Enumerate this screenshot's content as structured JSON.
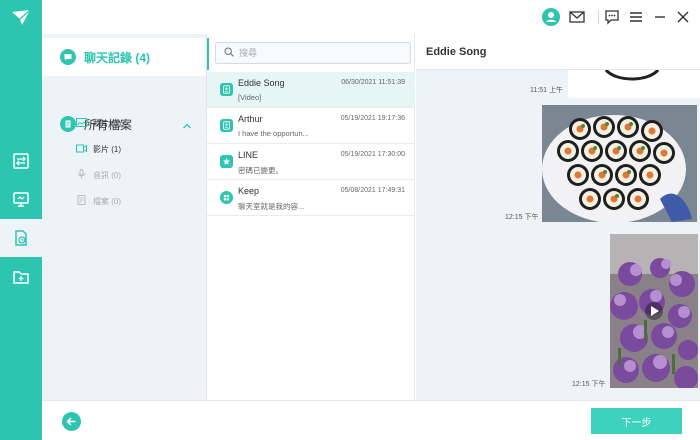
{
  "colors": {
    "accent": "#2ec5b0",
    "panel": "#eef3f8",
    "selected_row": "#e5f6f3"
  },
  "toolbar": {
    "icons": [
      "account-icon",
      "mail-icon",
      "feedback-icon",
      "menu-icon",
      "minimize-icon",
      "close-icon"
    ]
  },
  "rail": {
    "items": [
      "logo-icon",
      "transfer-icon",
      "device-icon",
      "backup-restore-icon",
      "folder-add-icon"
    ]
  },
  "categories": {
    "chat_history": "聊天記錄 (4)",
    "all_files": "所有檔案",
    "sub": [
      {
        "label": "照片 (1)",
        "enabled": true
      },
      {
        "label": "影片 (1)",
        "enabled": true
      },
      {
        "label": "音訊 (0)",
        "enabled": false
      },
      {
        "label": "檔案 (0)",
        "enabled": false
      }
    ]
  },
  "search": {
    "placeholder": "搜尋"
  },
  "messages": [
    {
      "name": "Eddie Song",
      "date": "06/30/2021 11:51:39",
      "preview": "[Video]",
      "selected": true
    },
    {
      "name": "Arthur",
      "date": "05/19/2021 19:17:36",
      "preview": "I have the opportun...",
      "selected": false
    },
    {
      "name": "LINE",
      "date": "05/19/2021 17:30:00",
      "preview": "密碼已變更。",
      "selected": false
    },
    {
      "name": "Keep",
      "date": "05/08/2021 17:49:31",
      "preview": "聊天室就是我的容...",
      "selected": false
    }
  ],
  "chat": {
    "title": "Eddie Song",
    "timestamps": [
      "11:51 上午",
      "12:15 下午",
      "12:15 下午"
    ]
  },
  "footer": {
    "next_label": "下一步"
  }
}
